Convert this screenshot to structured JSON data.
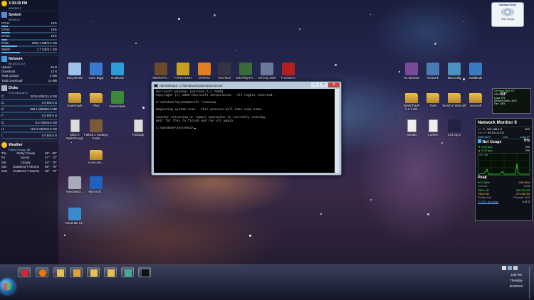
{
  "sidebar": {
    "clock": {
      "time": "3:30:39 PM",
      "date": "5/10/2012"
    },
    "system": {
      "title": "System",
      "uptime": "00:05:13"
    },
    "cpu_rows": [
      {
        "label": "CPU1",
        "value": "12%"
      },
      {
        "label": "CPU2",
        "value": "15%"
      },
      {
        "label": "CPU3",
        "value": "10%"
      }
    ],
    "ram": {
      "label": "RAM",
      "value": "1004.1 MB/3.5 GB"
    },
    "swap": {
      "label": "SWAP",
      "value": "1.7 GB/5.1 GB"
    },
    "network": {
      "title": "Network",
      "ip": "99.101.6.217",
      "rows": [
        {
          "label": "Upload",
          "value": "16 B"
        },
        {
          "label": "Download",
          "value": "13 B"
        },
        {
          "label": "Total Upload",
          "value": "2 MB"
        },
        {
          "label": "Total Download",
          "value": "14 MB"
        }
      ]
    },
    "disks": {
      "title": "Disks",
      "sub": "97% used of C:",
      "rows": [
        {
          "label": "C:",
          "value": "203.6 GB/211.9 GB"
        },
        {
          "label": "D:",
          "value": "0.0 B/0.0 B"
        },
        {
          "label": "E:",
          "value": "458.1 MB/658.0 MB"
        },
        {
          "label": "F:",
          "value": "0.0 B/0.0 B"
        },
        {
          "label": "G:",
          "value": "8.5 GB/29.9 GB"
        },
        {
          "label": "H:",
          "value": "152.2 GB/232.8 GB"
        },
        {
          "label": "I:",
          "value": "0.0 B/0.0 B"
        }
      ]
    },
    "weather": {
      "title": "Weather",
      "sub": "Partly Cloudy, 68°",
      "rows": [
        {
          "day": "Thu",
          "desc": "Partly Cloudy",
          "temp": "66° - 80°"
        },
        {
          "day": "Fri",
          "desc": "Sunny",
          "temp": "47° - 72°"
        },
        {
          "day": "Sat",
          "desc": "Cloudy",
          "temp": "54° - 75°"
        },
        {
          "day": "Sun",
          "desc": "Scattered T-Storms",
          "temp": "66° - 75°"
        },
        {
          "day": "Mon",
          "desc": "Scattered T-Storms",
          "temp": "66° - 75°"
        }
      ]
    }
  },
  "desktop_icons": [
    {
      "label": "Recycle Bin",
      "icon": "recycle-bin-icon",
      "color": "#9bc4e8"
    },
    {
      "label": "Core Temp",
      "icon": "core-temp-icon",
      "color": "#3a78d0"
    },
    {
      "label": "RealCalc",
      "icon": "calculator-icon",
      "color": "#2b9bd9"
    },
    {
      "label": "NEWGPO...",
      "icon": "game-icon",
      "color": "#6a4a2a"
    },
    {
      "label": "FORSAKEN",
      "icon": "game-icon",
      "color": "#c8a020"
    },
    {
      "label": "Defense",
      "icon": "radiation-icon",
      "color": "#e08020"
    },
    {
      "label": "SS2 Mod",
      "icon": "game-icon",
      "color": "#334"
    },
    {
      "label": "DBOPlayTR...",
      "icon": "game-icon",
      "color": "#3a6a3a"
    },
    {
      "label": "SimCity 2000",
      "icon": "game-icon",
      "color": "#6a7a9a"
    },
    {
      "label": "Freelancer",
      "icon": "game-icon",
      "color": "#b02020"
    },
    {
      "label": "Downloads",
      "icon": "folder-icon",
      "color": "#e8c050"
    },
    {
      "label": "Files",
      "icon": "folder-icon",
      "color": "#e8c050"
    },
    {
      "label": "Downloader",
      "icon": "download-icon",
      "color": "#3a8a3a"
    },
    {
      "label": "MDS-2 Walkthrough",
      "icon": "document-icon",
      "color": "#ddd"
    },
    {
      "label": "Fallout 2 Strategy Guide",
      "icon": "book-icon",
      "color": "#7a5a3a"
    },
    {
      "label": "Package",
      "icon": "package-icon",
      "color": "#ddd"
    },
    {
      "label": "unnecess...",
      "icon": "folder-icon",
      "color": "#e8c050"
    },
    {
      "label": "WindowsD...",
      "icon": "window-icon",
      "color": "#aab"
    },
    {
      "label": "Microsoft...",
      "icon": "microsoft-icon",
      "color": "#2060c0"
    },
    {
      "label": "Generate Cl...",
      "icon": "shortcut-icon",
      "color": "#3a8ad0"
    },
    {
      "label": "Tor Browser",
      "icon": "tor-icon",
      "color": "#7a4a9a"
    },
    {
      "label": "Network",
      "icon": "network-icon",
      "color": "#4a7ab0"
    },
    {
      "label": "MSConfig",
      "icon": "settings-icon",
      "color": "#4a90c0"
    },
    {
      "label": "GodMode",
      "icon": "control-panel-icon",
      "color": "#3a7ac0"
    },
    {
      "label": "WinWTrayP 2.2.1.151",
      "icon": "folder-icon",
      "color": "#e8c050"
    },
    {
      "label": "Tools",
      "icon": "folder-icon",
      "color": "#e8c050"
    },
    {
      "label": "World of Warcraft",
      "icon": "folder-icon",
      "color": "#e8c050"
    },
    {
      "label": "newcraft",
      "icon": "folder-icon",
      "color": "#e8c050"
    },
    {
      "label": "Tweaks",
      "icon": "document-icon",
      "color": "#eee"
    },
    {
      "label": "Content",
      "icon": "document-icon",
      "color": "#eee"
    },
    {
      "label": "S3TCfg 2",
      "icon": "s3-icon",
      "color": "#224"
    }
  ],
  "cmd": {
    "title": "Administrator: C:\\Windows\\System32\\cmd.exe",
    "lines": [
      "Microsoft Windows [Version 6.1.7600]",
      "Copyright (c) 2009 Microsoft Corporation.  All rights reserved.",
      "",
      "C:\\Windows\\System32>sfc /scannow",
      "",
      "Beginning system scan.  This process will take some time.",
      "",
      "Another servicing or repair operation is currently running.",
      "Wait for this to finish and run sfc again.",
      "",
      "C:\\Windows\\System32>"
    ]
  },
  "dock": {
    "title": "DaemonTools",
    "label": "SSD Empty"
  },
  "gpu": {
    "name": "GeForce 9500 GT",
    "label": "GPU",
    "temp": "53°",
    "load": "Load: 0%",
    "clock": "550MHz",
    "mem": "Mem: 32%",
    "fan": "Fan: 35%"
  },
  "netmon": {
    "title": "Network Monitor II",
    "int_ip_label": "Int. IP:",
    "int_ip": "192.168.1.3",
    "gw": "GW",
    "ext_ip_label": "Ext. IP:",
    "ext_ip": "99.101.6.217",
    "refresh": "Refresh IP",
    "info": "Info",
    "copy": "Copy IP",
    "usage_label": "Net Usage",
    "usage_value": "0%",
    "down_bps": "0.00 bps",
    "down_pct": "0%",
    "up_bps": "0.00 bps",
    "up_pct": "0%",
    "graph_max": "12.1 kb",
    "peak_label": "Peak",
    "peak_down": "50.0 kB/s",
    "peak_up": "255 kB/s",
    "current_label": "Current",
    "total_label": "Total",
    "cur_down": "456.1 kB",
    "tot_down": "335.33 GB",
    "cur_up": "758.4 kB",
    "tot_up": "274.35 GB",
    "profile": "Profile:N/A",
    "firewall": "Firewall: N/A",
    "footer": "© 2011 by Igogo",
    "version": "v.11.2"
  },
  "taskbar": {
    "buttons": [
      {
        "name": "chrome-taskbar-button",
        "icon": "chrome-icon",
        "color": "#d23"
      },
      {
        "name": "firefox-taskbar-button",
        "icon": "firefox-icon",
        "color": "#e70"
      },
      {
        "name": "explorer-taskbar-button",
        "icon": "folder-icon",
        "color": "#e8c050"
      },
      {
        "name": "media-player-taskbar-button",
        "icon": "media-player-icon",
        "color": "#e8a030"
      },
      {
        "name": "folder-taskbar-button-1",
        "icon": "folder-icon",
        "color": "#e8c050"
      },
      {
        "name": "folder-taskbar-button-2",
        "icon": "folder-icon",
        "color": "#e8c050"
      },
      {
        "name": "paint-taskbar-button",
        "icon": "paint-icon",
        "color": "#4a9"
      },
      {
        "name": "cmd-taskbar-button",
        "icon": "cmd-icon",
        "color": "#111"
      }
    ],
    "clock": {
      "time": "3:30 PM",
      "day": "Thursday",
      "date": "5/10/2012"
    }
  }
}
